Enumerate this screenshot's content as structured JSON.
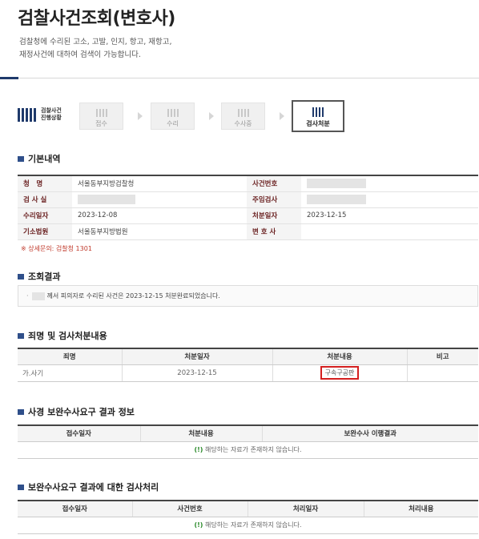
{
  "page": {
    "title": "검찰사건조회(변호사)",
    "desc_line1": "검찰청에 수리된 고소, 고발, 인지, 항고, 재항고,",
    "desc_line2": "재정사건에 대하여 검색이 가능합니다."
  },
  "progress": {
    "label_line1": "검찰사건",
    "label_line2": "진행상황",
    "steps": [
      "접수",
      "수리",
      "수사중",
      "검사처분"
    ],
    "active_step": "검사처분"
  },
  "basic": {
    "heading": "기본내역",
    "labels": {
      "name": "청　명",
      "case_no": "사건번호",
      "office": "검 사 실",
      "prosecutor": "주임검사",
      "received": "수리일자",
      "disposed": "처분일자",
      "court": "기소법원",
      "lawyer": "변 호 사"
    },
    "values": {
      "name": "서울동부지방검찰청",
      "received": "2023-12-08",
      "disposed": "2023-12-15",
      "court": "서울동부지방법원"
    },
    "note": "※ 상세문의: 검찰청 1301"
  },
  "result": {
    "heading": "조회결과",
    "bullet": "·",
    "text": "께서 피의자로 수리된 사건은 2023-12-15 처분완료되었습니다."
  },
  "charges": {
    "heading": "죄명 및 검사처분내용",
    "columns": [
      "죄명",
      "처분일자",
      "처분내용",
      "비고"
    ],
    "rows": [
      {
        "charge": "가.사기",
        "date": "2023-12-15",
        "content": "구속구공판",
        "remark": ""
      }
    ]
  },
  "police_supplement": {
    "heading": "사경 보완수사요구 결과 정보",
    "columns": [
      "접수일자",
      "처분내용",
      "보완수사 이행결과"
    ],
    "empty_mark": "(!)",
    "empty_text": "해당하는 자료가 존재하지 않습니다."
  },
  "prosecutor_processing": {
    "heading": "보완수사요구 결과에 대한 검사처리",
    "columns": [
      "접수일자",
      "사건번호",
      "처리일자",
      "처리내용"
    ],
    "empty_mark": "(!)",
    "empty_text": "해당하는 자료가 존재하지 않습니다."
  }
}
